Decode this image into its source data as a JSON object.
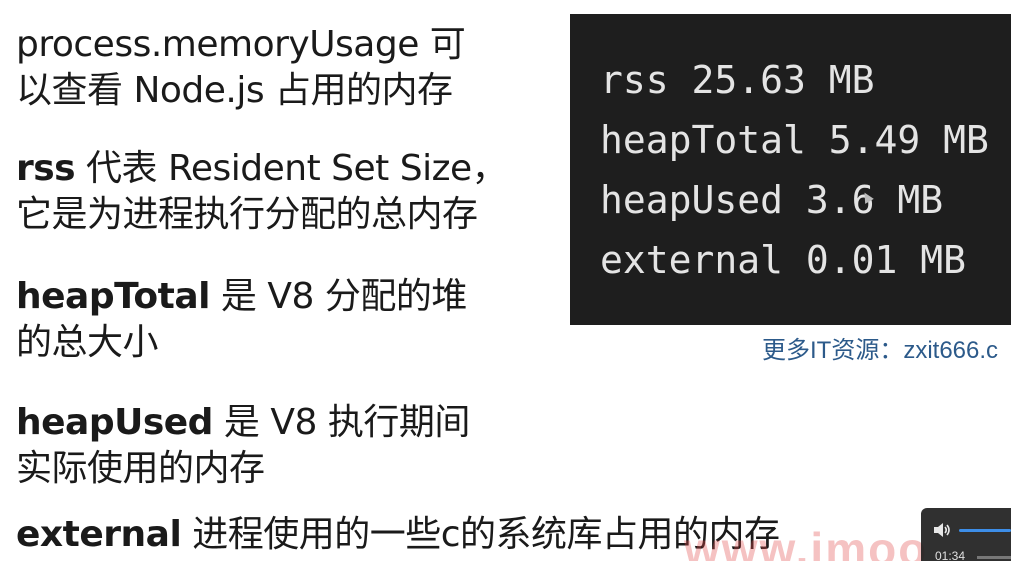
{
  "slide": {
    "p1_line1": "process.memoryUsage 可",
    "p1_line2": "以查看 Node.js 占用的内存",
    "p2_term": "rss",
    "p2_line1_rest": " 代表 Resident Set Size，",
    "p2_line2": "它是为进程执行分配的总内存",
    "p3_term": "heapTotal",
    "p3_line1_rest": " 是 V8 分配的堆",
    "p3_line2": "的总大小",
    "p4_term": "heapUsed",
    "p4_line1_rest": " 是 V8 执行期间",
    "p4_line2": "实际使用的内存",
    "p5_term": "external",
    "p5_line1_rest": " 进程使用的一些c的系统库占用的内存"
  },
  "terminal": {
    "lines": [
      "rss 25.63 MB",
      "heapTotal 5.49 MB",
      "heapUsed 3.6 MB",
      "external 0.01 MB"
    ]
  },
  "resource_note": "更多IT资源：zxit666.c",
  "watermark": "www.imoo",
  "player": {
    "time": "01:34",
    "volume_icon": "speaker-icon",
    "accent_color": "#3d8ee8",
    "volume_level": 1.0
  }
}
